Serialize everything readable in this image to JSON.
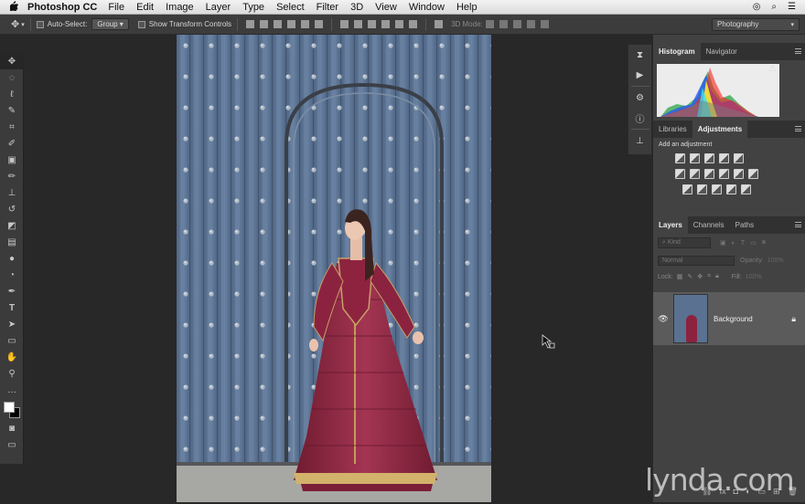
{
  "menubar": {
    "app_name": "Photoshop CC",
    "items": [
      "File",
      "Edit",
      "Image",
      "Layer",
      "Type",
      "Select",
      "Filter",
      "3D",
      "View",
      "Window",
      "Help"
    ]
  },
  "options_bar": {
    "auto_select_label": "Auto-Select:",
    "auto_select_value": "Group",
    "transform_controls_label": "Show Transform Controls",
    "mode_3d_label": "3D Mode:",
    "workspace_value": "Photography"
  },
  "histogram_panel": {
    "tabs": [
      "Histogram",
      "Navigator"
    ],
    "active_tab": "Histogram",
    "warning_icon": "warning-triangle-icon"
  },
  "adjustments_panel": {
    "tabs": [
      "Libraries",
      "Adjustments"
    ],
    "active_tab": "Adjustments",
    "heading": "Add an adjustment"
  },
  "layers_panel": {
    "tabs": [
      "Layers",
      "Channels",
      "Paths"
    ],
    "active_tab": "Layers",
    "filter_placeholder": "Kind",
    "blend_mode": "Normal",
    "opacity_label": "Opacity:",
    "opacity_value": "100%",
    "lock_label": "Lock:",
    "fill_label": "Fill:",
    "fill_value": "100%",
    "layers": [
      {
        "name": "Background",
        "visible": true,
        "locked": true
      }
    ]
  },
  "watermark": {
    "text": "lynda.com"
  },
  "colors": {
    "ui_dark": "#282828",
    "panel": "#424242",
    "door": "#5a7191",
    "dress": "#8b2340"
  }
}
